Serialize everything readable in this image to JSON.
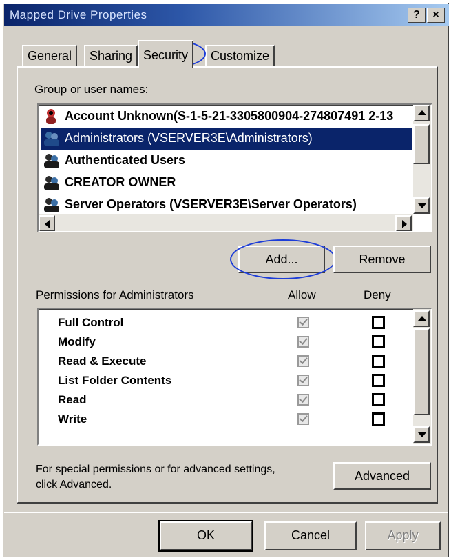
{
  "window": {
    "title": "Mapped Drive Properties",
    "help_button": "?",
    "close_button": "×"
  },
  "tabs": [
    {
      "label": "General",
      "active": false
    },
    {
      "label": "Sharing",
      "active": false
    },
    {
      "label": "Security",
      "active": true
    },
    {
      "label": "Customize",
      "active": false
    }
  ],
  "group_label": "Group or user names:",
  "users": [
    {
      "name": "Account Unknown(S-1-5-21-3305800904-274807491 2-13",
      "icon": "unknown-user-icon",
      "selected": false
    },
    {
      "name": "Administrators (VSERVER3E\\Administrators)",
      "icon": "group-icon",
      "selected": true
    },
    {
      "name": "Authenticated Users",
      "icon": "group-icon",
      "selected": false
    },
    {
      "name": "CREATOR OWNER",
      "icon": "group-icon",
      "selected": false
    },
    {
      "name": "Server Operators (VSERVER3E\\Server Operators)",
      "icon": "group-icon",
      "selected": false
    }
  ],
  "buttons": {
    "add": "Add...",
    "remove": "Remove",
    "advanced": "Advanced",
    "ok": "OK",
    "cancel": "Cancel",
    "apply": "Apply"
  },
  "permissions": {
    "header": "Permissions for Administrators",
    "allow_header": "Allow",
    "deny_header": "Deny",
    "rows": [
      {
        "name": "Full Control",
        "allow": true,
        "deny": false
      },
      {
        "name": "Modify",
        "allow": true,
        "deny": false
      },
      {
        "name": "Read & Execute",
        "allow": true,
        "deny": false
      },
      {
        "name": "List Folder Contents",
        "allow": true,
        "deny": false
      },
      {
        "name": "Read",
        "allow": true,
        "deny": false
      },
      {
        "name": "Write",
        "allow": true,
        "deny": false
      }
    ]
  },
  "advanced_note": {
    "line1": "For special permissions or for advanced settings,",
    "line2": "click Advanced."
  },
  "colors": {
    "face": "#d4d0c8",
    "selection": "#0a246a",
    "annotation": "#1c3cd8"
  }
}
